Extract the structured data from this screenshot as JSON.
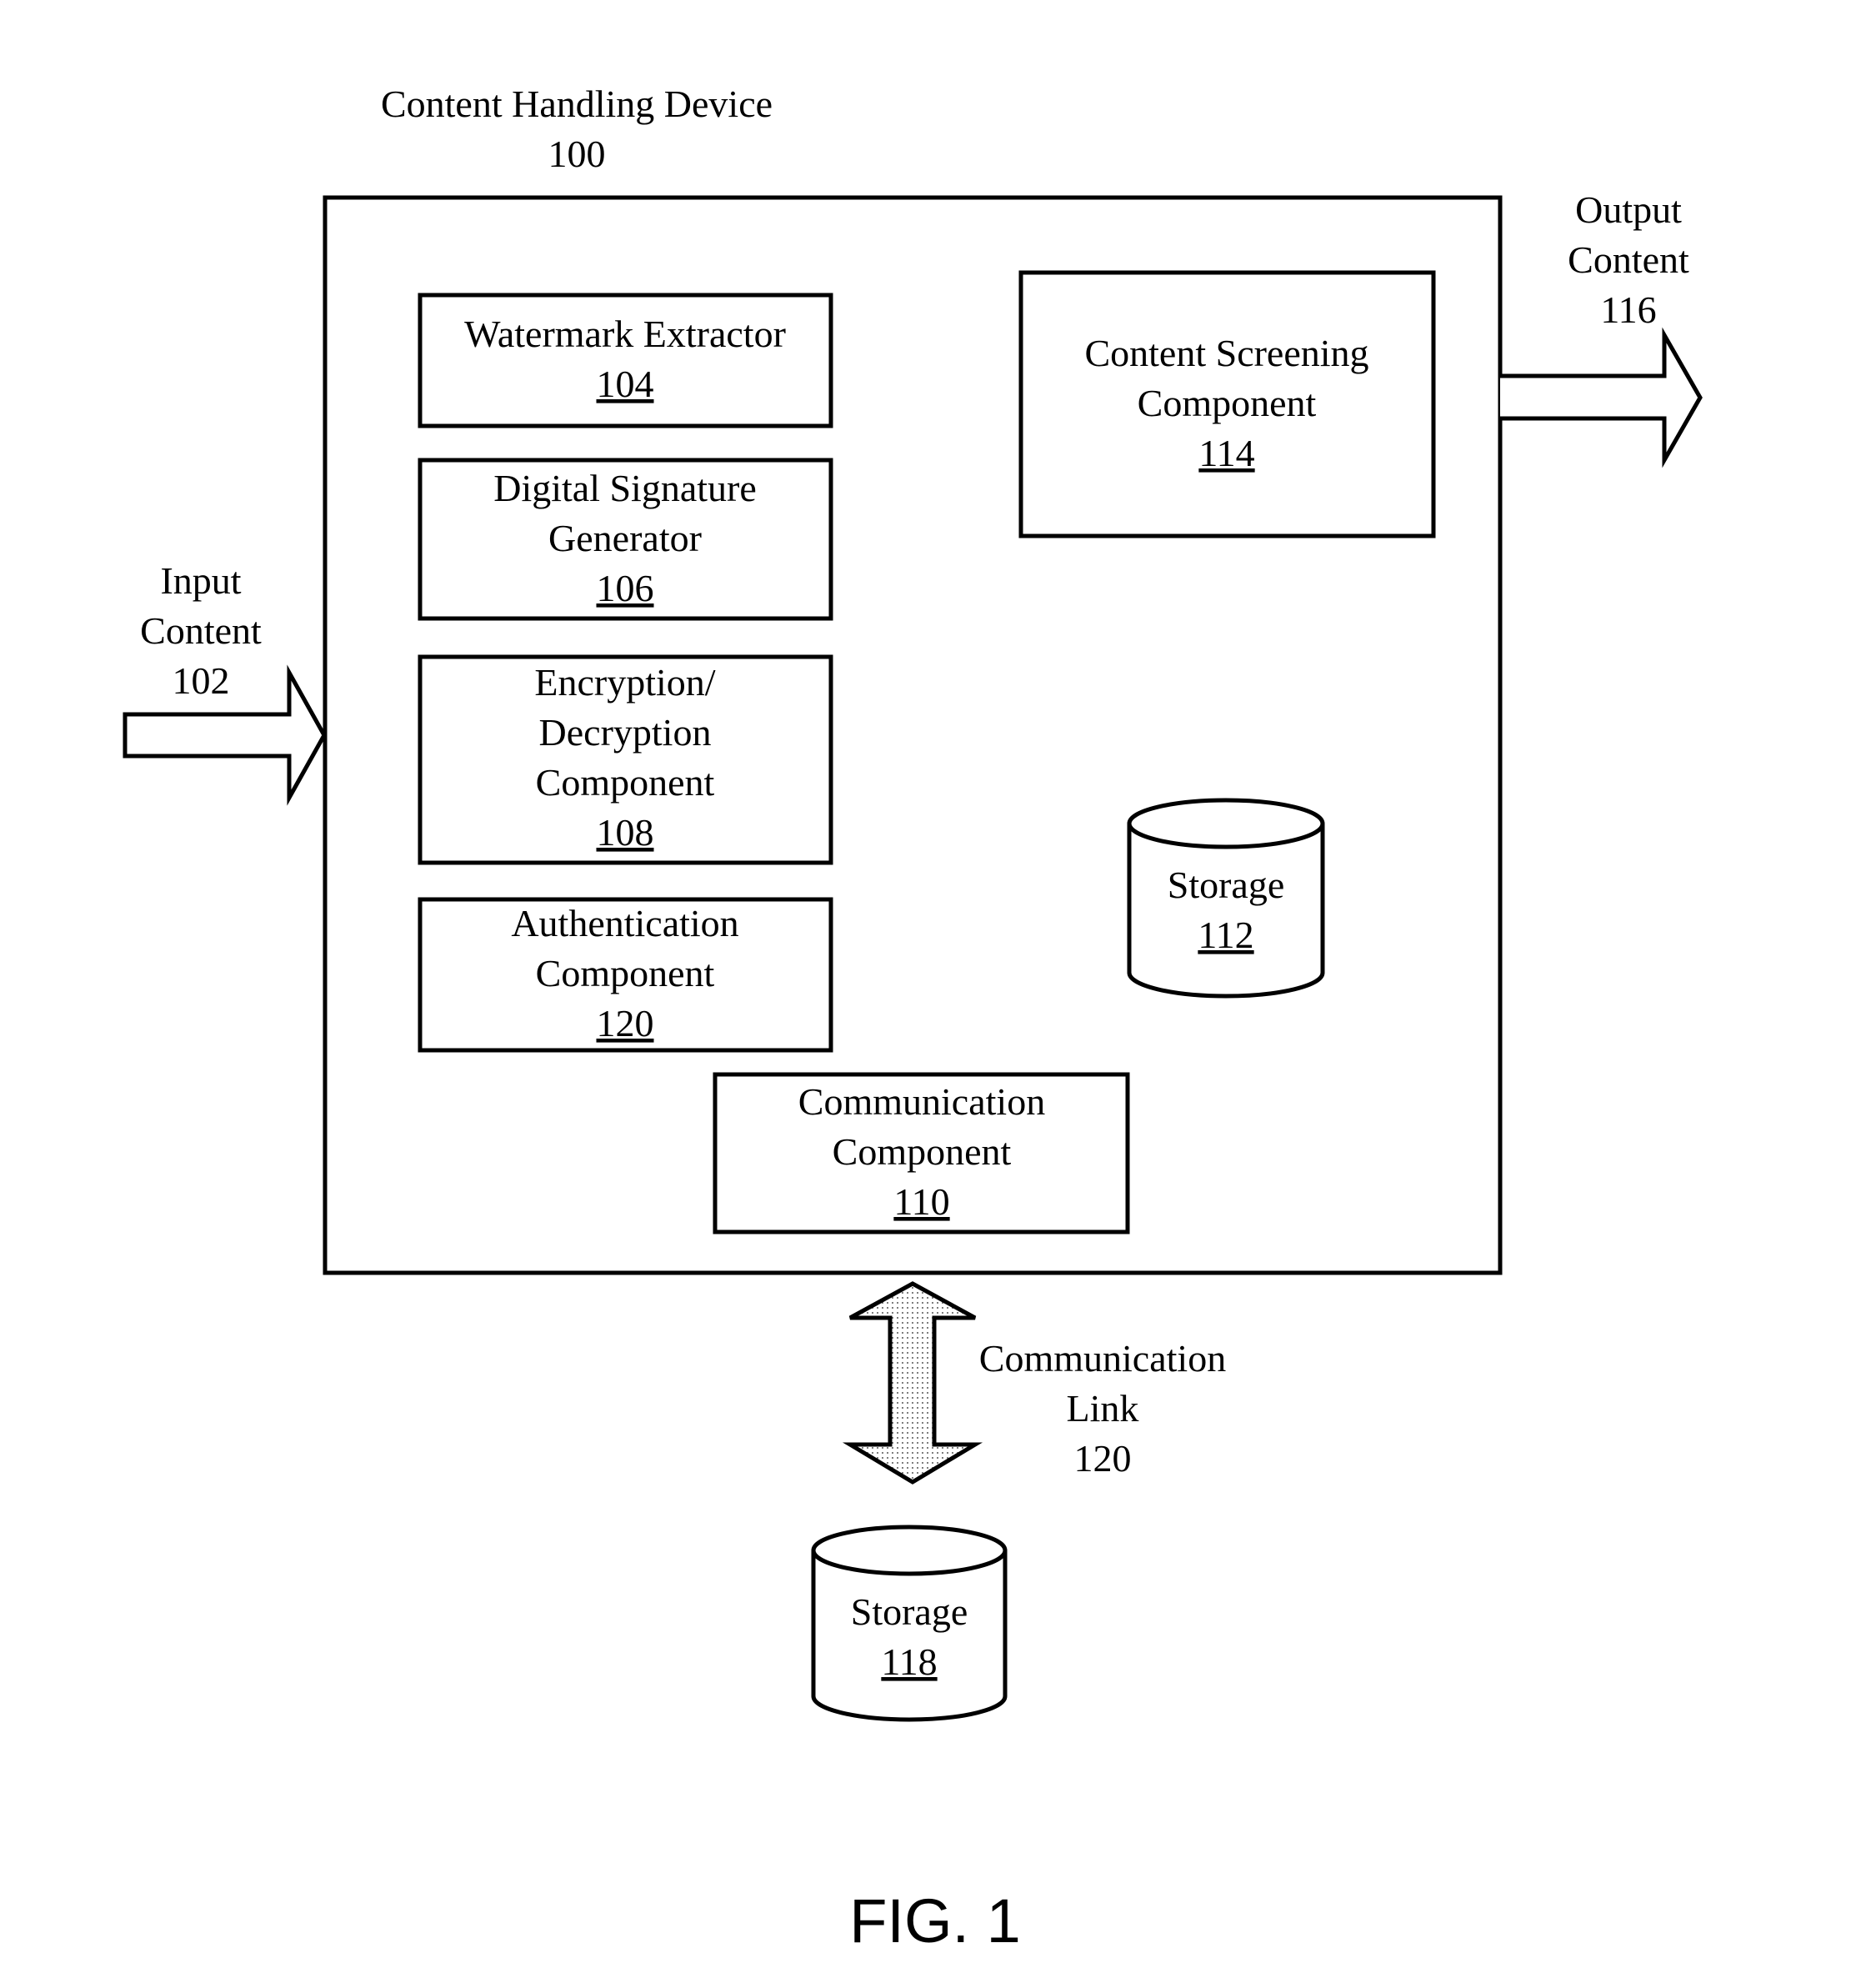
{
  "figure": {
    "caption": "FIG. 1",
    "device": {
      "title": "Content Handling Device",
      "ref": "100"
    },
    "input": {
      "lines": [
        "Input",
        "Content"
      ],
      "ref": "102"
    },
    "output": {
      "lines": [
        "Output",
        "Content"
      ],
      "ref": "116"
    },
    "link": {
      "lines": [
        "Communication",
        "Link"
      ],
      "ref": "120"
    },
    "components": [
      {
        "id": "watermark-extractor",
        "lines": [
          "Watermark Extractor"
        ],
        "ref": "104"
      },
      {
        "id": "digital-signature-generator",
        "lines": [
          "Digital Signature",
          "Generator"
        ],
        "ref": "106"
      },
      {
        "id": "encryption-decryption-component",
        "lines": [
          "Encryption/",
          "Decryption",
          "Component"
        ],
        "ref": "108"
      },
      {
        "id": "authentication-component",
        "lines": [
          "Authentication",
          "Component"
        ],
        "ref": "120"
      },
      {
        "id": "communication-component",
        "lines": [
          "Communication",
          "Component"
        ],
        "ref": "110"
      },
      {
        "id": "content-screening-component",
        "lines": [
          "Content Screening",
          "Component"
        ],
        "ref": "114"
      }
    ],
    "storage_internal": {
      "label": "Storage",
      "ref": "112"
    },
    "storage_external": {
      "label": "Storage",
      "ref": "118"
    },
    "colors": {
      "stroke": "#000000",
      "background": "#ffffff",
      "link_fill": "#e8e8e8"
    }
  }
}
